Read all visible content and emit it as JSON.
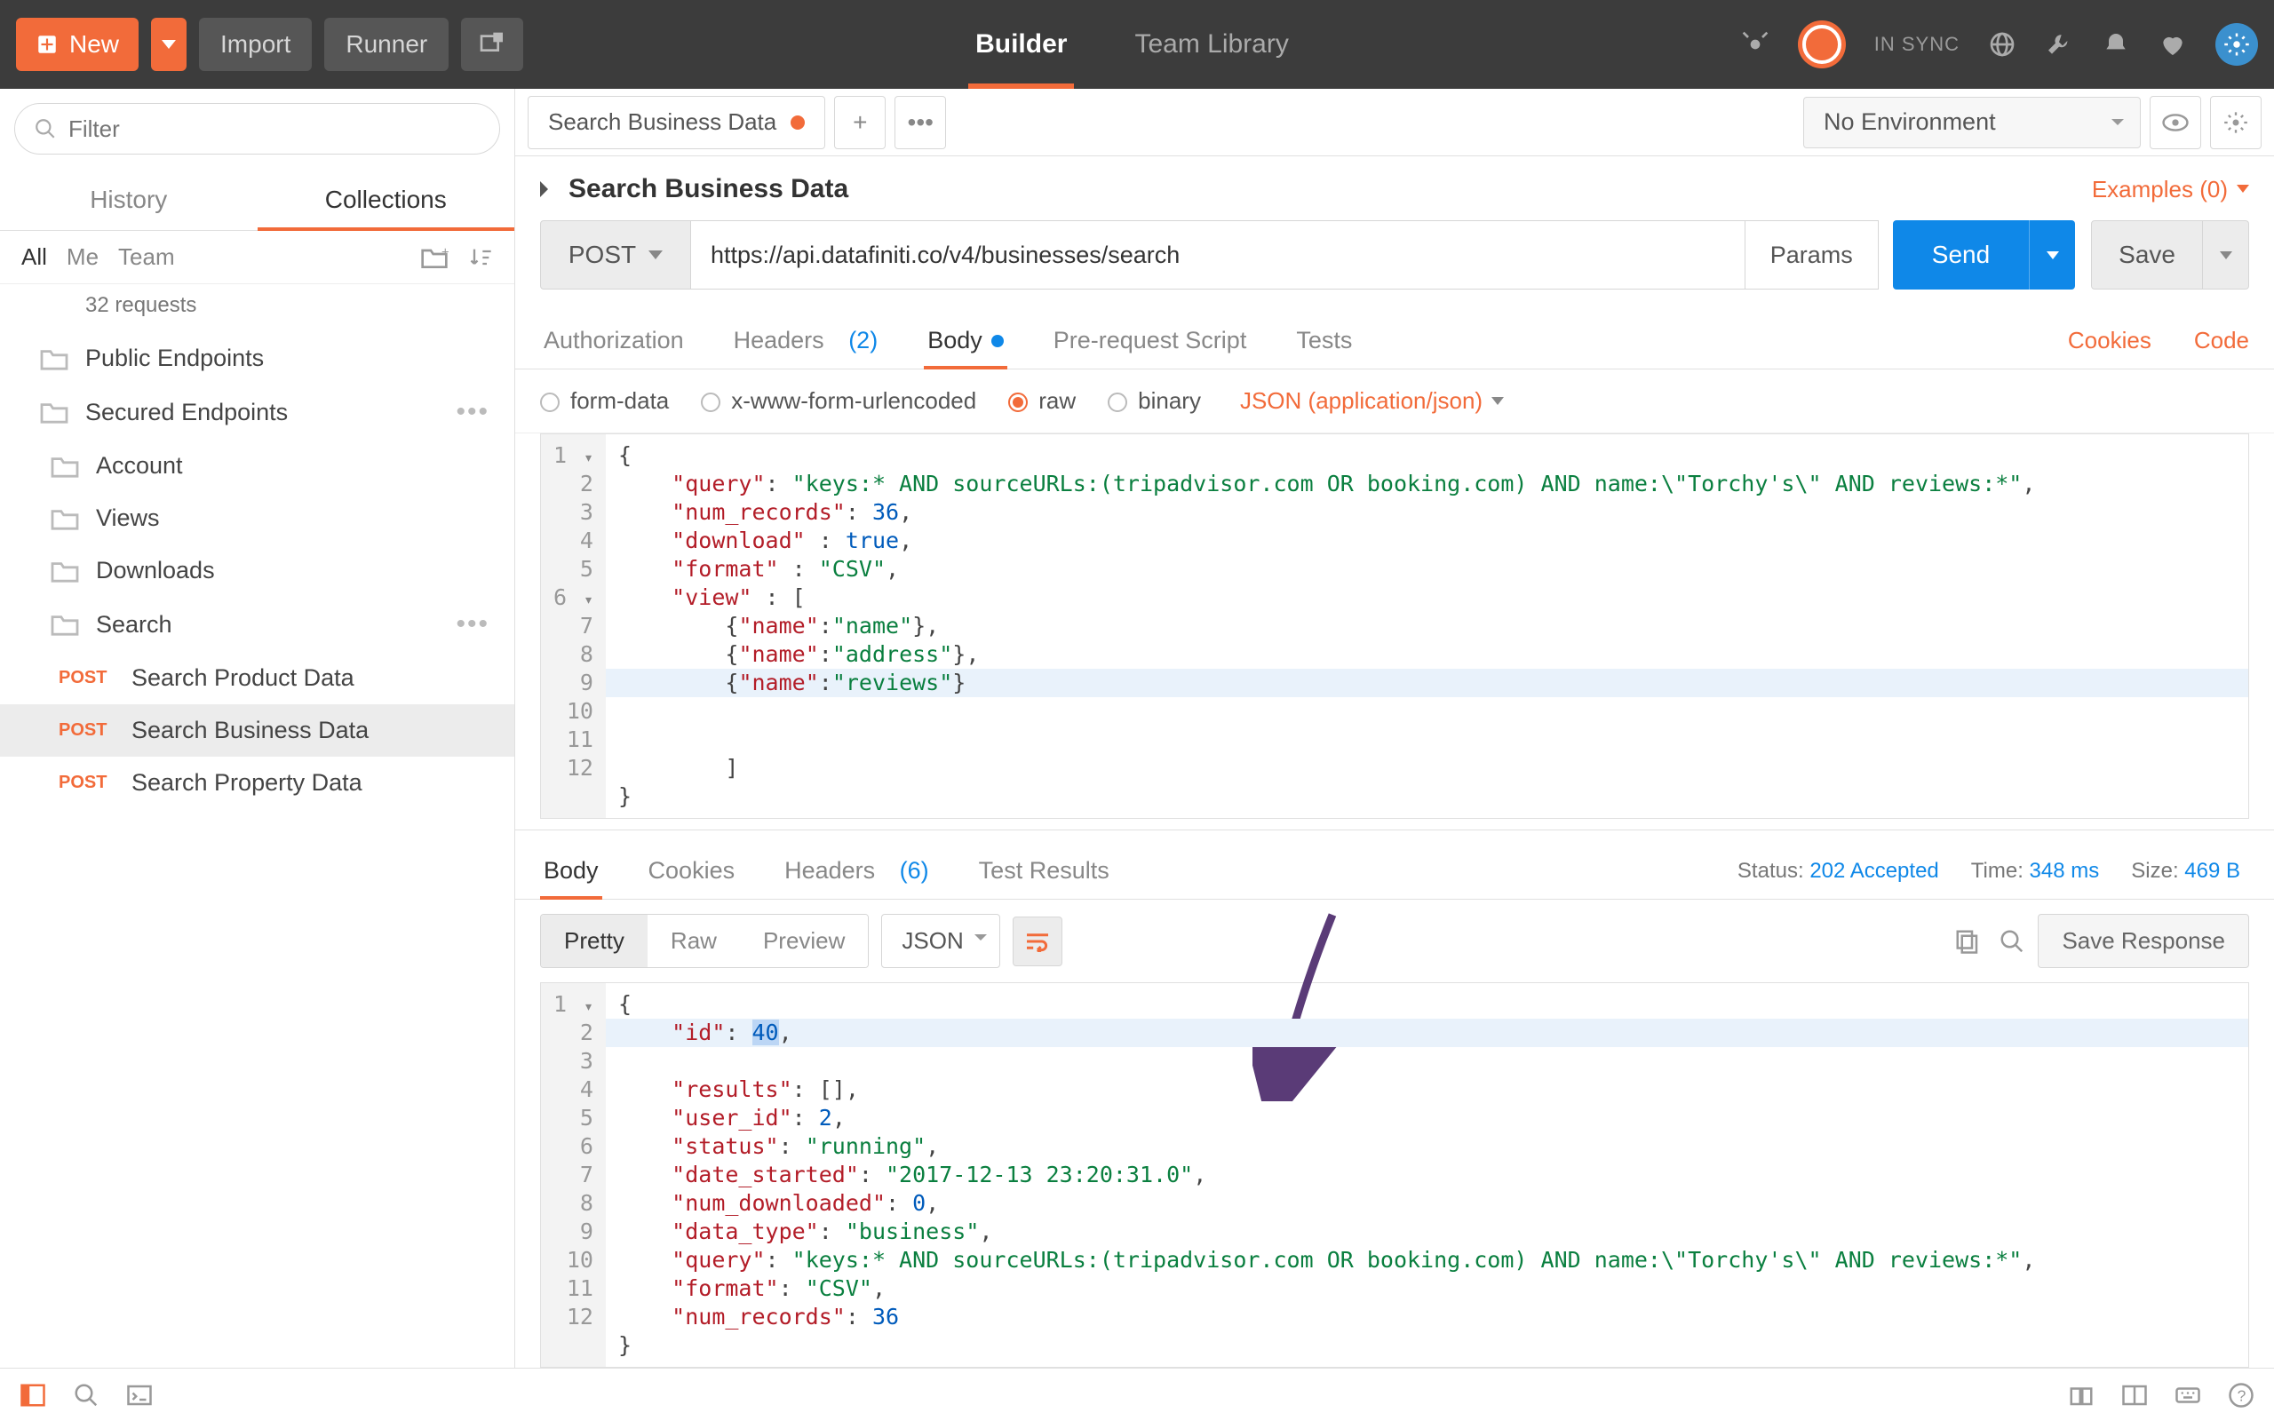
{
  "topbar": {
    "new_label": "New",
    "import_label": "Import",
    "runner_label": "Runner",
    "center_tabs": [
      "Builder",
      "Team Library"
    ],
    "sync_label": "IN SYNC"
  },
  "sidebar": {
    "filter_placeholder": "Filter",
    "tabs": [
      "History",
      "Collections"
    ],
    "scopes": [
      "All",
      "Me",
      "Team"
    ],
    "collection_sub": "32 requests",
    "items": [
      {
        "label": "Public Endpoints"
      },
      {
        "label": "Secured Endpoints",
        "dots": true
      },
      {
        "label": "Account",
        "indent": 2
      },
      {
        "label": "Views",
        "indent": 2
      },
      {
        "label": "Downloads",
        "indent": 2
      },
      {
        "label": "Search",
        "indent": 2,
        "dots": true,
        "open": true
      }
    ],
    "leaves": [
      {
        "method": "POST",
        "label": "Search Product Data"
      },
      {
        "method": "POST",
        "label": "Search Business Data",
        "active": true
      },
      {
        "method": "POST",
        "label": "Search Property Data"
      }
    ]
  },
  "envbar": {
    "selected": "No Environment"
  },
  "request": {
    "tab_label": "Search Business Data",
    "title": "Search Business Data",
    "examples_label": "Examples (0)",
    "method": "POST",
    "url": "https://api.datafiniti.co/v4/businesses/search",
    "params_label": "Params",
    "send_label": "Send",
    "save_label": "Save",
    "subtabs": {
      "authorization": "Authorization",
      "headers": "Headers",
      "headers_count": "(2)",
      "body": "Body",
      "prerequest": "Pre-request Script",
      "tests": "Tests",
      "cookies": "Cookies",
      "code": "Code"
    },
    "body_types": [
      "form-data",
      "x-www-form-urlencoded",
      "raw",
      "binary"
    ],
    "body_json_label": "JSON (application/json)"
  },
  "request_body": {
    "query": "keys:* AND sourceURLs:(tripadvisor.com OR booking.com) AND name:\\\"Torchy's\\\" AND reviews:*",
    "num_records": 36,
    "download": true,
    "format": "CSV",
    "view": [
      {
        "name": "name"
      },
      {
        "name": "address"
      },
      {
        "name": "reviews"
      }
    ]
  },
  "response": {
    "tabs": {
      "body": "Body",
      "cookies": "Cookies",
      "headers": "Headers",
      "headers_count": "(6)",
      "tests": "Test Results"
    },
    "status_label": "Status:",
    "status_value": "202 Accepted",
    "time_label": "Time:",
    "time_value": "348 ms",
    "size_label": "Size:",
    "size_value": "469 B",
    "views": [
      "Pretty",
      "Raw",
      "Preview"
    ],
    "format": "JSON",
    "save_response": "Save Response"
  },
  "response_body": {
    "id": 40,
    "results": [],
    "user_id": 2,
    "status": "running",
    "date_started": "2017-12-13 23:20:31.0",
    "num_downloaded": 0,
    "data_type": "business",
    "query": "keys:* AND sourceURLs:(tripadvisor.com OR booking.com) AND name:\\\"Torchy's\\\" AND reviews:*",
    "format": "CSV",
    "num_records": 36
  }
}
